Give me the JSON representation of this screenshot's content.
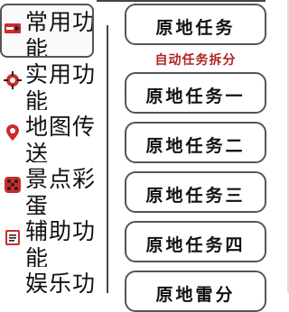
{
  "sidebar": {
    "items": [
      {
        "label": "常用功能",
        "icon": "tag-icon",
        "active": true
      },
      {
        "label": "实用功能",
        "icon": "crosshair-icon",
        "active": false
      },
      {
        "label": "地图传送",
        "icon": "map-pin-icon",
        "active": false
      },
      {
        "label": "景点彩蛋",
        "icon": "dice-icon",
        "active": false
      },
      {
        "label": "辅助功能",
        "icon": "clipboard-icon",
        "active": false
      },
      {
        "label": "娱乐功能",
        "icon": "",
        "active": false
      }
    ]
  },
  "main": {
    "top_button": "原地任务",
    "section_title": "自动任务拆分",
    "tasks": [
      "原地任务一",
      "原地任务二",
      "原地任务三",
      "原地任务四",
      "原地雷分"
    ]
  },
  "colors": {
    "section_title": "#b22222",
    "icon_red": "#cc2b2b",
    "border": "#555555"
  }
}
